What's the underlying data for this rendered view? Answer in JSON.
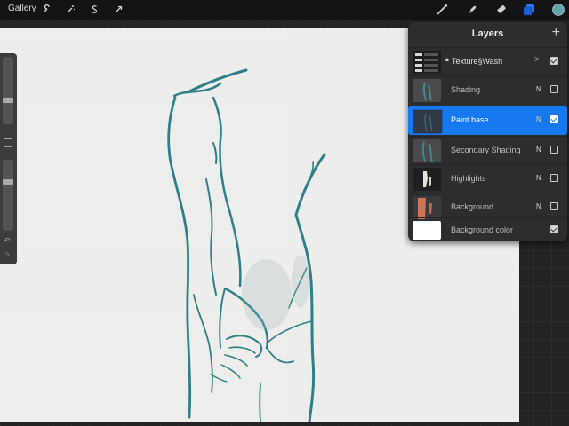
{
  "topbar": {
    "gallery_label": "Gallery",
    "left_icons": [
      "wrench-icon",
      "magic-wand-icon",
      "selection-icon",
      "transform-arrow-icon"
    ],
    "right_icons": [
      "brush-icon",
      "smudge-icon",
      "eraser-icon",
      "layers-icon",
      "color-swatch"
    ],
    "active_color": "#5fa6a8",
    "accent": "#1679ef"
  },
  "sidebar": {
    "undo_icon": "↶",
    "redo_icon": "↷"
  },
  "layers_panel": {
    "title": "Layers",
    "add_label": "+",
    "group": {
      "name": "Texture§Wash",
      "checked": true
    },
    "layers": [
      {
        "name": "Shading",
        "mode": "N",
        "checked": false,
        "selected": false
      },
      {
        "name": "Paint base",
        "mode": "N",
        "checked": true,
        "selected": true
      },
      {
        "name": "Secondary Shading",
        "mode": "N",
        "checked": false,
        "selected": false
      },
      {
        "name": "Highlights",
        "mode": "N",
        "checked": false,
        "selected": false
      },
      {
        "name": "Background",
        "mode": "N",
        "checked": false,
        "selected": false
      }
    ],
    "background_color": {
      "name": "Background color",
      "checked": true,
      "swatch": "#ffffff"
    }
  },
  "sketch": {
    "stroke_color": "#2f7f88"
  }
}
